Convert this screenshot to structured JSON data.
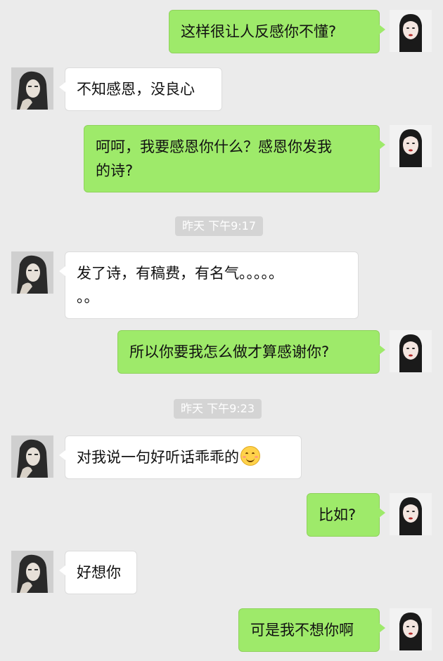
{
  "colors": {
    "background": "#ebebeb",
    "sent_bubble": "#9eea6a",
    "received_bubble": "#ffffff",
    "timestamp_bg": "#d4d4d4"
  },
  "messages": [
    {
      "side": "right",
      "text": "这样很让人反感你不懂?"
    },
    {
      "side": "left",
      "text": "不知感恩，没良心"
    },
    {
      "side": "right",
      "text": "呵呵，我要感恩你什么？感恩你发我\n的诗?"
    },
    {
      "timestamp": "昨天 下午9:17"
    },
    {
      "side": "left",
      "text": "发了诗，有稿费，有名气。。。。。\n。。"
    },
    {
      "side": "right",
      "text": "所以你要我怎么做才算感谢你?"
    },
    {
      "timestamp": "昨天 下午9:23"
    },
    {
      "side": "left",
      "text": "对我说一句好听话乖乖的",
      "emoji": "smiling-face-emoji"
    },
    {
      "side": "right",
      "text": "比如?"
    },
    {
      "side": "left",
      "text": "好想你"
    },
    {
      "side": "right",
      "text": "可是我不想你啊"
    }
  ]
}
